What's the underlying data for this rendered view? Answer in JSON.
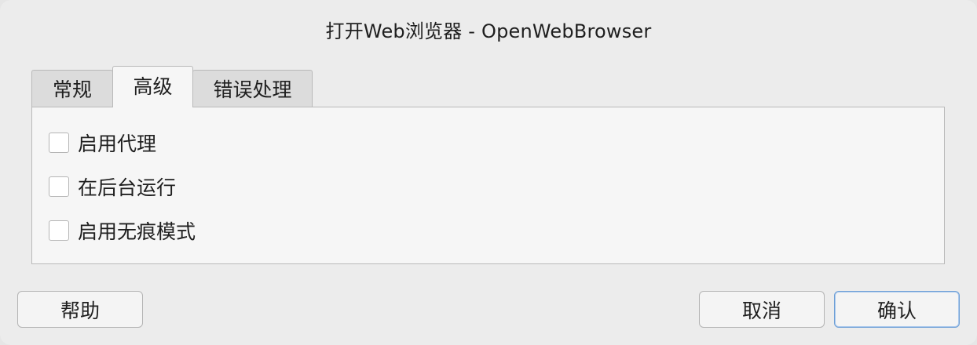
{
  "window": {
    "title": "打开Web浏览器 - OpenWebBrowser"
  },
  "tabs": [
    {
      "label": "常规",
      "selected": false
    },
    {
      "label": "高级",
      "selected": true
    },
    {
      "label": "错误处理",
      "selected": false
    }
  ],
  "options": [
    {
      "label": "启用代理",
      "checked": false
    },
    {
      "label": "在后台运行",
      "checked": false
    },
    {
      "label": "启用无痕模式",
      "checked": false
    }
  ],
  "buttons": {
    "help": "帮助",
    "cancel": "取消",
    "ok": "确认"
  },
  "colors": {
    "dialog_background": "#ececec",
    "panel_background": "#f6f6f6",
    "default_button_border": "#6e9fd6"
  }
}
